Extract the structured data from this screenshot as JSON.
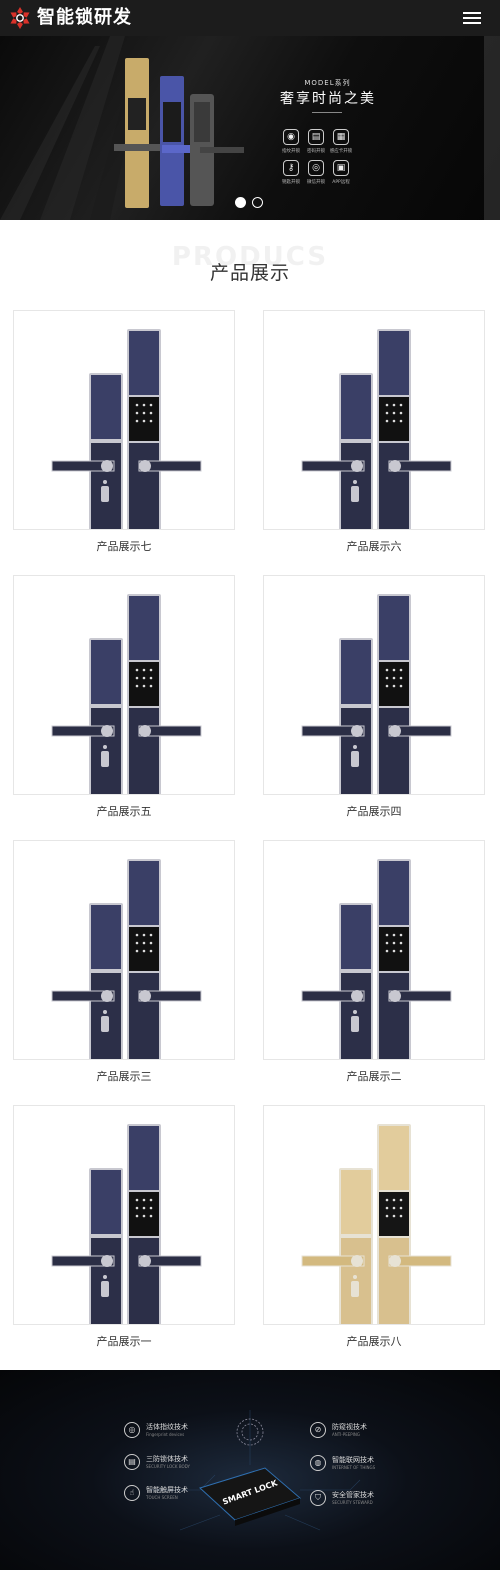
{
  "brand": {
    "title": "智能锁研发",
    "accent": "#d9322a",
    "header_bg": "#1c1c1c"
  },
  "header": {
    "menu_icon": "hamburger-menu-icon"
  },
  "banner": {
    "model_line": "MODEL系列",
    "slogan": "奢享时尚之美",
    "features": [
      {
        "icon": "fingerprint-icon",
        "glyph": "◉",
        "label": "指纹开锁"
      },
      {
        "icon": "keypad-icon",
        "glyph": "▤",
        "label": "密码开锁"
      },
      {
        "icon": "card-icon",
        "glyph": "▦",
        "label": "感应卡开锁"
      },
      {
        "icon": "key-icon",
        "glyph": "⚷",
        "label": "钥匙开锁"
      },
      {
        "icon": "phone-icon",
        "glyph": "◎",
        "label": "微信开锁"
      },
      {
        "icon": "app-icon",
        "glyph": "▣",
        "label": "APP远程"
      }
    ],
    "slides_total": 2,
    "slide_active": 1
  },
  "products": {
    "bg_text": "PRODUCS",
    "title": "产品展示",
    "items": [
      {
        "name": "产品展示七",
        "finish": "navy"
      },
      {
        "name": "产品展示六",
        "finish": "navy"
      },
      {
        "name": "产品展示五",
        "finish": "navy"
      },
      {
        "name": "产品展示四",
        "finish": "navy"
      },
      {
        "name": "产品展示三",
        "finish": "navy"
      },
      {
        "name": "产品展示二",
        "finish": "navy"
      },
      {
        "name": "产品展示一",
        "finish": "navy"
      },
      {
        "name": "产品展示八",
        "finish": "gold"
      }
    ]
  },
  "footer": {
    "chip_label": "SMART LOCK",
    "left_features": [
      {
        "icon": "fingerprint-icon",
        "glyph": "◎",
        "title": "活体指纹技术",
        "sub": "Fingerprint devices"
      },
      {
        "icon": "lock-icon",
        "glyph": "▤",
        "title": "三防锁体技术",
        "sub": "SECURITY LOCK BODY"
      },
      {
        "icon": "hand-icon",
        "glyph": "☝",
        "title": "智能触屏技术",
        "sub": "TOUCH SCREEN"
      }
    ],
    "right_features": [
      {
        "icon": "eye-off-icon",
        "glyph": "⊘",
        "title": "防窥视技术",
        "sub": "ANTI-PEEPING"
      },
      {
        "icon": "wifi-icon",
        "glyph": "◍",
        "title": "智能联网技术",
        "sub": "INTERNET OF THINGS"
      },
      {
        "icon": "shield-icon",
        "glyph": "⛉",
        "title": "安全管家技术",
        "sub": "SECURITY STEWARD"
      }
    ]
  }
}
